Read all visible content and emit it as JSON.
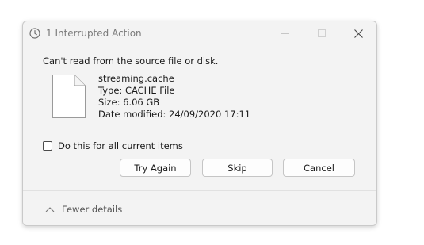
{
  "dialog": {
    "title": "1 Interrupted Action",
    "message": "Can't read from the source file or disk.",
    "file": {
      "name": "streaming.cache",
      "type": "Type: CACHE File",
      "size": "Size: 6.06 GB",
      "modified": "Date modified: 24/09/2020 17:11"
    },
    "checkbox": {
      "label": "Do this for all current items",
      "checked": false
    },
    "buttons": {
      "try_again": "Try Again",
      "skip": "Skip",
      "cancel": "Cancel"
    },
    "footer": {
      "toggle_label": "Fewer details"
    }
  },
  "icons": {
    "title": "clock-icon",
    "file": "document-icon",
    "minimize": "minimize-icon",
    "maximize": "maximize-icon",
    "close": "close-icon",
    "chevron": "chevron-up-icon"
  },
  "colors": {
    "dialog_bg": "#f3f3f3",
    "button_bg": "#fdfdfd",
    "border": "#c5c5c5",
    "muted_text": "#7a7a7a"
  }
}
